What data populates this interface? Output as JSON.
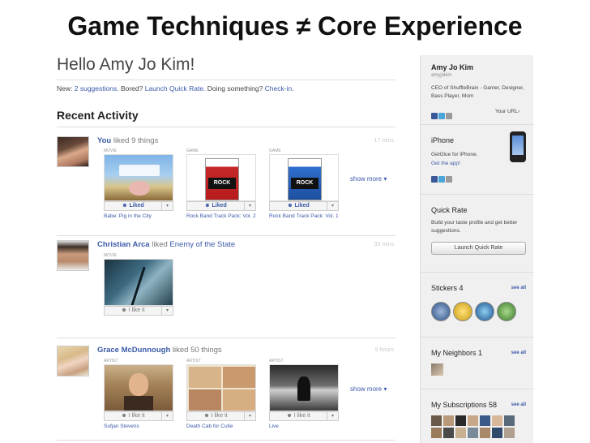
{
  "slide": {
    "title": "Game Techniques ≠ Core Experience"
  },
  "main": {
    "greeting": "Hello Amy Jo Kim!",
    "new_prefix": "New:",
    "suggestions_link": "2 suggestions.",
    "bored_text": "Bored?",
    "quick_rate_link": "Launch Quick Rate.",
    "doing_text": "Doing something?",
    "checkin_link": "Check-in.",
    "recent_heading": "Recent Activity",
    "show_more": "show more ▾",
    "entries": [
      {
        "name": "You",
        "action": "liked 9 things",
        "object": "",
        "time": "17 mins",
        "cards": [
          {
            "tag": "MOVIE",
            "like": "Liked",
            "caption": "Babe: Pig in the City"
          },
          {
            "tag": "GAME",
            "like": "Liked",
            "caption": "Rock Band Track Pack: Vol. 2"
          },
          {
            "tag": "GAME",
            "like": "Liked",
            "caption": "Rock Band Track Pack: Vol. 1"
          }
        ]
      },
      {
        "name": "Christian Arca",
        "action": "liked",
        "object": "Enemy of the State",
        "time": "33 mins",
        "cards": [
          {
            "tag": "MOVIE",
            "like": "I like it",
            "caption": ""
          }
        ]
      },
      {
        "name": "Grace McDunnough",
        "action": "liked 50 things",
        "object": "",
        "time": "9 hours",
        "cards": [
          {
            "tag": "ARTIST",
            "like": "I like it",
            "caption": "Sufjan Stevens"
          },
          {
            "tag": "ARTIST",
            "like": "I like it",
            "caption": "Death Cab for Cutie"
          },
          {
            "tag": "ARTIST",
            "like": "I like it",
            "caption": "Live"
          }
        ]
      }
    ]
  },
  "sidebar": {
    "profile": {
      "name": "Amy Jo Kim",
      "handle": "amyjokim",
      "bio": "CEO of ShuffleBrain - Gamer, Designer, Bass Player, Mom",
      "your_url": "Your URL›"
    },
    "iphone": {
      "title": "iPhone",
      "text": "GetGlue for iPhone.",
      "link": "Get the app!"
    },
    "quick_rate": {
      "title": "Quick Rate",
      "text": "Build your taste profile and get better suggestions.",
      "button": "Launch Quick Rate"
    },
    "stickers": {
      "title": "Stickers 4",
      "see_all": "see all"
    },
    "neighbors": {
      "title": "My Neighbors 1",
      "see_all": "see all"
    },
    "subscriptions": {
      "title": "My Subscriptions 58",
      "see_all": "see all"
    }
  },
  "colors": {
    "link": "#3b5aa8",
    "facebook": "#3b5998",
    "twitter": "#4aa6d9",
    "email": "#9a9a9a"
  },
  "icons": [
    "facebook-icon",
    "twitter-icon",
    "email-icon",
    "iphone-icon",
    "liked-thumb-icon",
    "dropdown-arrow-icon"
  ]
}
